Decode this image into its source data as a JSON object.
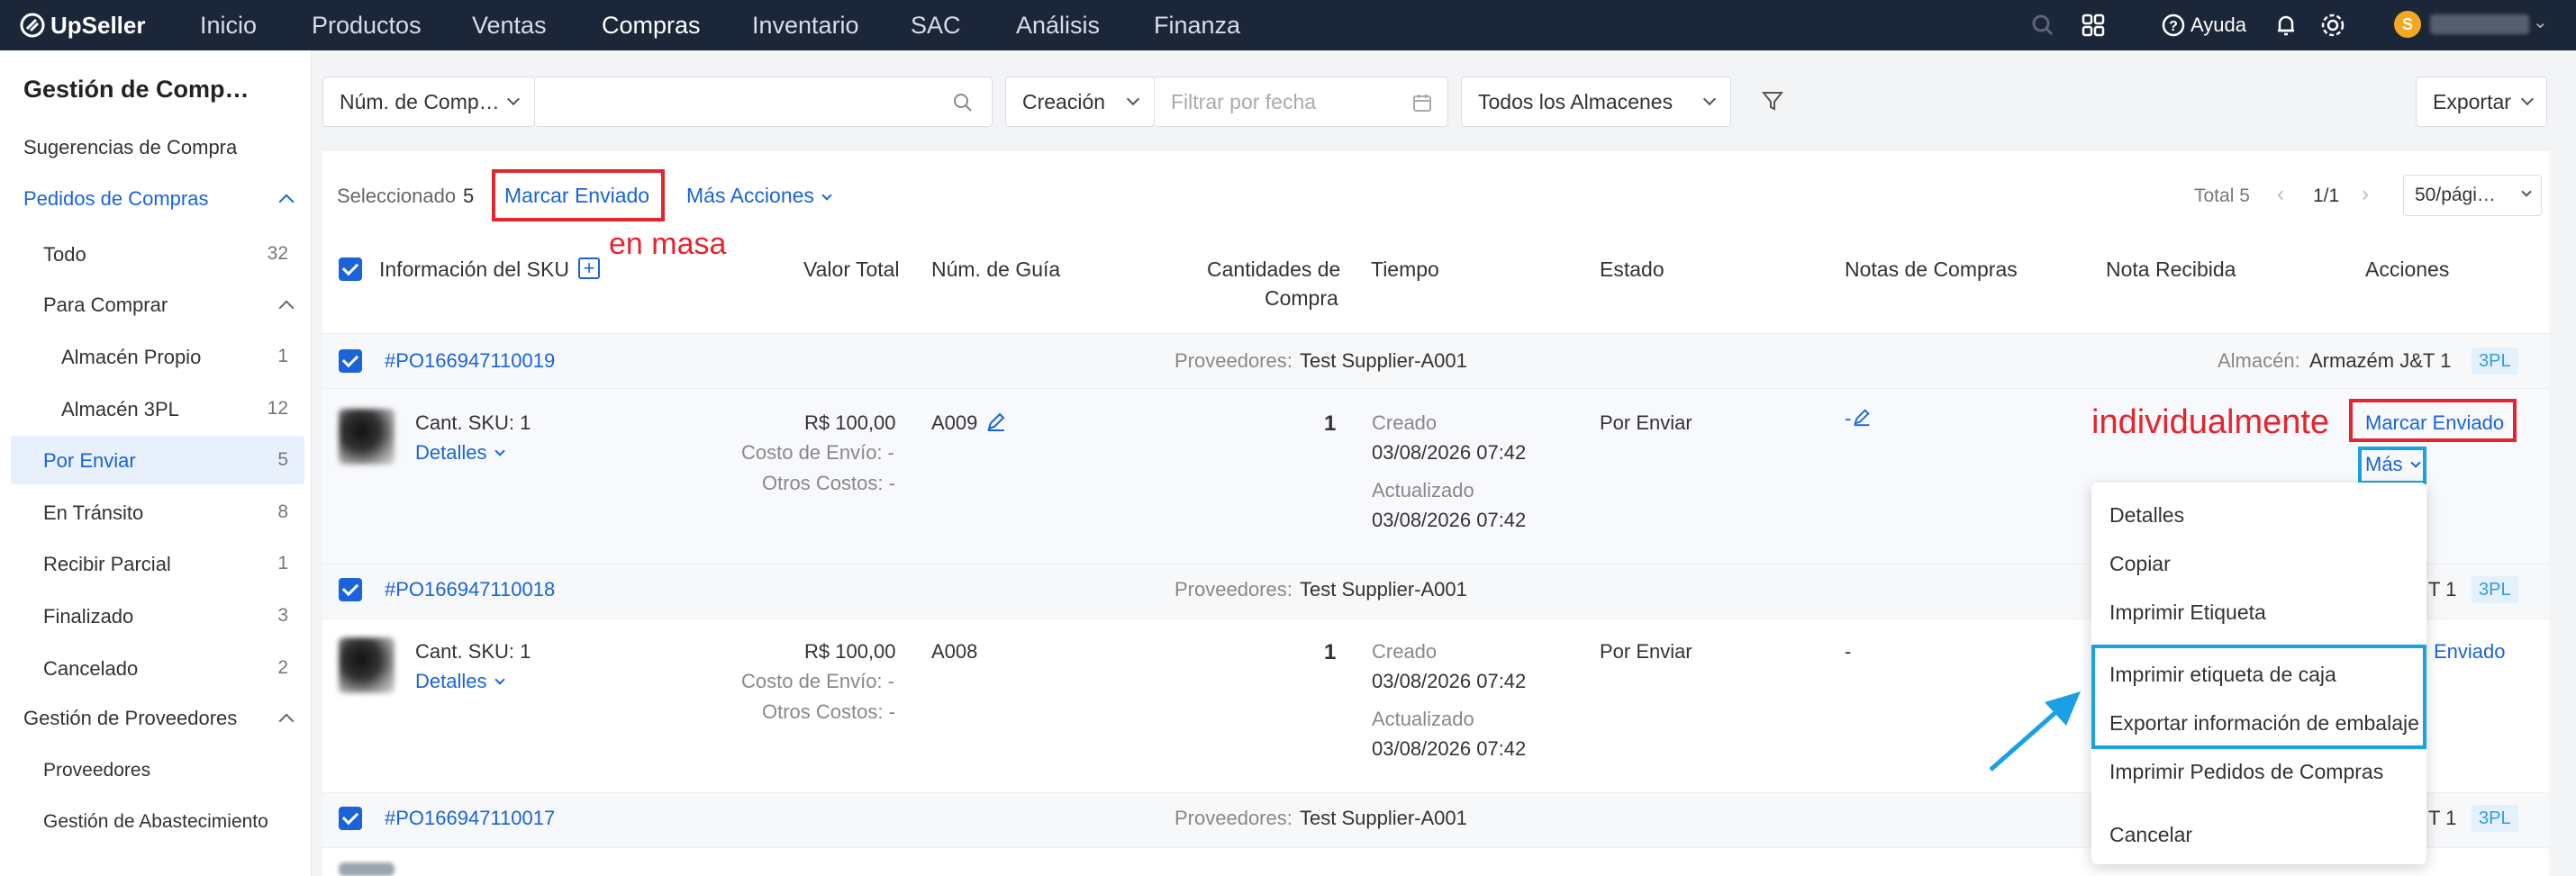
{
  "app": {
    "brand": "UpSeller",
    "nav": [
      "Inicio",
      "Productos",
      "Ventas",
      "Compras",
      "Inventario",
      "SAC",
      "Análisis",
      "Finanza"
    ],
    "active_nav": "Compras",
    "help": "Ayuda",
    "avatar_letter": "S"
  },
  "sidebar": {
    "title": "Gestión de Comp…",
    "sugerencias": "Sugerencias de Compra",
    "pedidos": "Pedidos de Compras",
    "items": [
      {
        "label": "Todo",
        "count": "32"
      },
      {
        "label": "Para Comprar",
        "count": ""
      },
      {
        "label": "Almacén Propio",
        "count": "1"
      },
      {
        "label": "Almacén 3PL",
        "count": "12"
      },
      {
        "label": "Por Enviar",
        "count": "5"
      },
      {
        "label": "En Tránsito",
        "count": "8"
      },
      {
        "label": "Recibir Parcial",
        "count": "1"
      },
      {
        "label": "Finalizado",
        "count": "3"
      },
      {
        "label": "Cancelado",
        "count": "2"
      }
    ],
    "proveedores_group": "Gestión de Proveedores",
    "proveedores": "Proveedores",
    "abastecimiento": "Gestión de Abastecimiento"
  },
  "filters": {
    "search_type": "Núm. de Comp…",
    "date_type": "Creación",
    "date_placeholder": "Filtrar por fecha",
    "warehouse": "Todos los Almacenes",
    "export": "Exportar"
  },
  "toolbar": {
    "selected_label": "Seleccionado",
    "selected_count": "5",
    "mark_sent": "Marcar Enviado",
    "more_actions": "Más Acciones",
    "total": "Total 5",
    "page": "1/1",
    "page_size": "50/pági…"
  },
  "annotations": {
    "bulk": "en masa",
    "individual": "individualmente"
  },
  "columns": [
    "Información del SKU",
    "Valor Total",
    "Núm. de Guía",
    "Cantidades de",
    "Compra",
    "Tiempo",
    "Estado",
    "Notas de Compras",
    "Nota Recibida",
    "Acciones"
  ],
  "orders": [
    {
      "id": "#PO166947110019",
      "supplier_label": "Proveedores:",
      "supplier": "Test Supplier-A001",
      "warehouse_label": "Almacén:",
      "warehouse": "Armazém J&T 1",
      "tag": "3PL",
      "sku": "Cant. SKU: 1",
      "details": "Detalles",
      "value": "R$ 100,00",
      "shipping": "Costo de Envío: -",
      "other": "Otros Costos: -",
      "tracking": "A009",
      "qty": "1",
      "created_label": "Creado",
      "created": "03/08/2026 07:42",
      "updated_label": "Actualizado",
      "updated": "03/08/2026 07:42",
      "status": "Por Enviar",
      "notes": "-",
      "action": "Marcar Enviado",
      "more": "Más"
    },
    {
      "id": "#PO166947110018",
      "supplier_label": "Proveedores:",
      "supplier": "Test Supplier-A001",
      "warehouse_partial": "T 1",
      "tag": "3PL",
      "sku": "Cant. SKU: 1",
      "details": "Detalles",
      "value": "R$ 100,00",
      "shipping": "Costo de Envío: -",
      "other": "Otros Costos: -",
      "tracking": "A008",
      "qty": "1",
      "created_label": "Creado",
      "created": "03/08/2026 07:42",
      "updated_label": "Actualizado",
      "updated": "03/08/2026 07:42",
      "status": "Por Enviar",
      "notes": "-",
      "action_partial": "Enviado"
    },
    {
      "id": "#PO166947110017",
      "supplier_label": "Proveedores:",
      "supplier": "Test Supplier-A001",
      "warehouse_partial": "T 1",
      "tag": "3PL"
    }
  ],
  "dropdown": [
    "Detalles",
    "Copiar",
    "Imprimir Etiqueta",
    "Imprimir etiqueta de caja",
    "Exportar información de embalaje",
    "Imprimir Pedidos de Compras",
    "Cancelar"
  ],
  "colors": {
    "topbar": "#1b2638",
    "accent": "#1a63d8",
    "highlight_red": "#e5252d",
    "highlight_blue": "#1ba1e2"
  }
}
